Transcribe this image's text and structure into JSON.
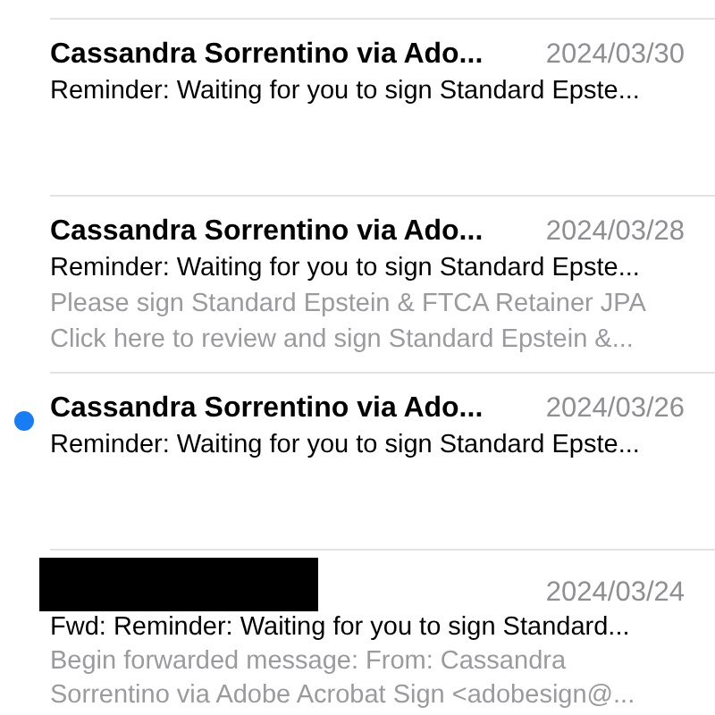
{
  "messages": [
    {
      "sender": "Cassandra Sorrentino via Ado...",
      "sender_redacted": false,
      "unread": false,
      "date": "2024/03/30",
      "subject": "Reminder: Waiting for you to sign Standard Epste..."
    },
    {
      "sender": "Cassandra Sorrentino via Ado...",
      "sender_redacted": false,
      "unread": false,
      "date": "2024/03/28",
      "subject": "Reminder: Waiting for you to sign Standard Epste...",
      "preview_lines": [
        "Please sign Standard Epstein & FTCA Retainer JPA",
        "Click here to review and sign Standard Epstein &..."
      ]
    },
    {
      "sender": "Cassandra Sorrentino via Ado...",
      "sender_redacted": false,
      "unread": true,
      "date": "2024/03/26",
      "subject": "Reminder: Waiting for you to sign Standard Epste..."
    },
    {
      "sender_redacted": true,
      "unread": false,
      "date": "2024/03/24",
      "subject": "Fwd: Reminder: Waiting for you to sign Standard...",
      "preview_lines": [
        "Begin forwarded message: From: Cassandra",
        "Sorrentino via Adobe Acrobat Sign <adobesign@..."
      ]
    }
  ]
}
